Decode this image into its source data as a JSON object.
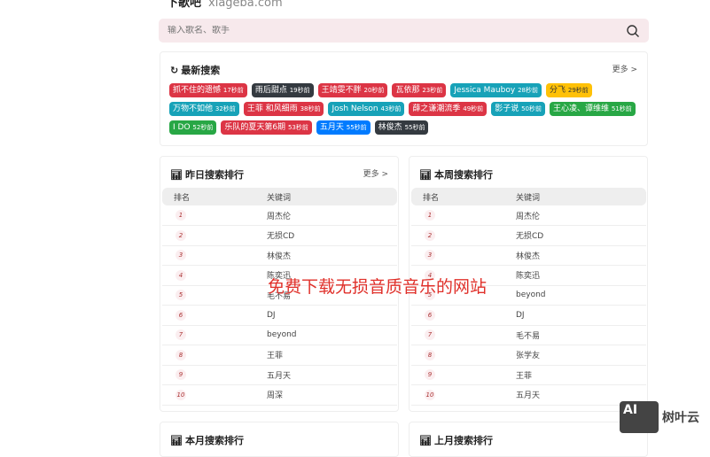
{
  "site": {
    "name": "下歌吧",
    "domain": "xiageba.com"
  },
  "search": {
    "placeholder": "输入歌名、歌手"
  },
  "latest": {
    "title": "最新搜索",
    "more": "更多 >",
    "tags": [
      {
        "name": "抓不住的遗憾",
        "time": "17秒前",
        "color": "#dc3545"
      },
      {
        "name": "雨后甜点",
        "time": "19秒前",
        "color": "#343a40"
      },
      {
        "name": "王靖雯不胖",
        "time": "20秒前",
        "color": "#dc3545"
      },
      {
        "name": "瓦依那",
        "time": "23秒前",
        "color": "#dc3545"
      },
      {
        "name": "Jessica Mauboy",
        "time": "28秒前",
        "color": "#17a2b8"
      },
      {
        "name": "分飞",
        "time": "29秒前",
        "color": "#ffc107"
      },
      {
        "name": "万物不如他",
        "time": "32秒前",
        "color": "#17a2b8"
      },
      {
        "name": "王菲 和风细雨",
        "time": "38秒前",
        "color": "#dc3545"
      },
      {
        "name": "Josh Nelson",
        "time": "43秒前",
        "color": "#17a2b8"
      },
      {
        "name": "薛之谦潮流季",
        "time": "49秒前",
        "color": "#dc3545"
      },
      {
        "name": "影子说",
        "time": "50秒前",
        "color": "#17a2b8"
      },
      {
        "name": "王心凌、谭维维",
        "time": "51秒前",
        "color": "#28a745"
      },
      {
        "name": "I DO",
        "time": "52秒前",
        "color": "#28a745"
      },
      {
        "name": "乐队的夏天第6期",
        "time": "53秒前",
        "color": "#dc3545"
      },
      {
        "name": "五月天",
        "time": "55秒前",
        "color": "#007bff"
      },
      {
        "name": "林俊杰",
        "time": "55秒前",
        "color": "#343a40"
      }
    ]
  },
  "yesterday": {
    "title": "昨日搜索排行",
    "more": "更多 >",
    "col_rank": "排名",
    "col_kw": "关键词",
    "rows": [
      "周杰伦",
      "无损CD",
      "林俊杰",
      "陈奕迅",
      "毛不易",
      "DJ",
      "beyond",
      "王菲",
      "五月天",
      "周深"
    ]
  },
  "week": {
    "title": "本周搜索排行",
    "col_rank": "排名",
    "col_kw": "关键词",
    "rows": [
      "周杰伦",
      "无损CD",
      "林俊杰",
      "陈奕迅",
      "beyond",
      "DJ",
      "毛不易",
      "张学友",
      "王菲",
      "五月天"
    ]
  },
  "month": {
    "title": "本月搜索排行"
  },
  "lastmonth": {
    "title": "上月搜索排行"
  },
  "overlay": "免费下载无损音质音乐的网站",
  "watermark": {
    "logo": "AI",
    "text": "树叶云"
  }
}
